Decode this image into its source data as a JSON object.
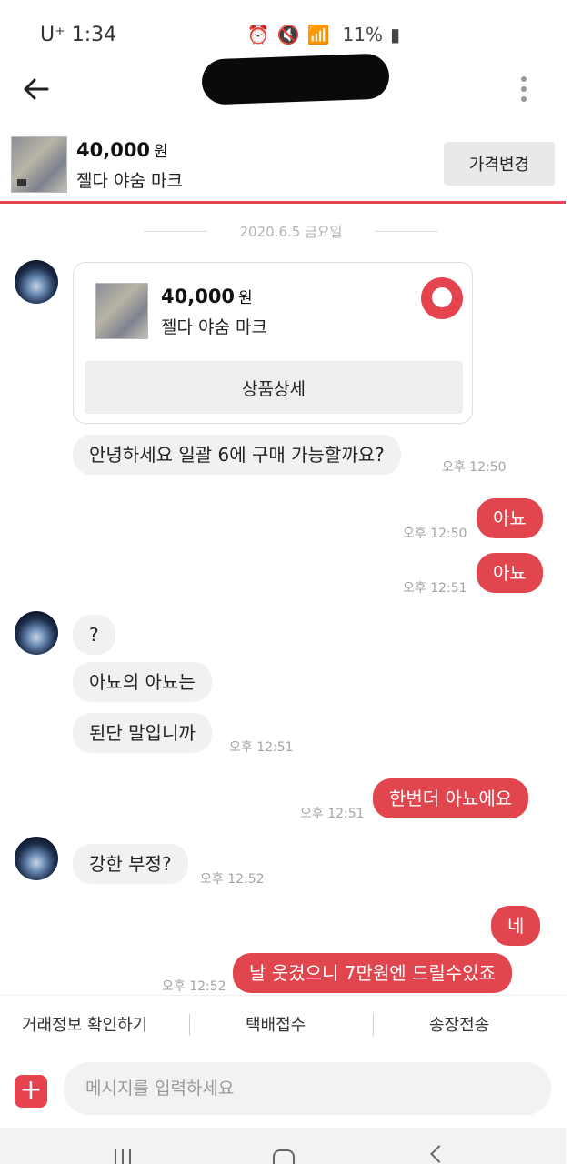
{
  "status_bar": {
    "carrier": "U⁺ 1:34",
    "battery": "11%"
  },
  "header": {
    "subtitle": ""
  },
  "product": {
    "price": "40,000",
    "currency": "원",
    "name": "젤다 야숨 마크",
    "price_change_label": "가격변경"
  },
  "chat": {
    "date": "2020.6.5 금요일",
    "card": {
      "price": "40,000",
      "currency": "원",
      "name": "젤다 야숨 마크",
      "detail_label": "상품상세"
    },
    "messages": [
      {
        "text": "안녕하세요 일괄 6에 구매 가능할까요?",
        "time": "오후 12:50"
      },
      {
        "text": "아뇨",
        "time": "오후 12:50"
      },
      {
        "text": "아뇨",
        "time": "오후 12:51"
      },
      {
        "text": "?"
      },
      {
        "text": "아뇨의 아뇨는"
      },
      {
        "text": "된단 말입니까",
        "time": "오후 12:51"
      },
      {
        "text": "한번더 아뇨에요",
        "time": "오후 12:51"
      },
      {
        "text": "강한 부정?",
        "time": "오후 12:52"
      },
      {
        "text": "네"
      },
      {
        "text": "날 웃겼으니 7만원엔 드릴수있죠",
        "time": "오후 12:52"
      }
    ]
  },
  "actions": {
    "trade_info": "거래정보 확인하기",
    "parcel": "택배접수",
    "invoice": "송장전송"
  },
  "composer": {
    "placeholder": "메시지를 입력하세요",
    "plus": "+"
  },
  "colors": {
    "accent": "#e5434d"
  }
}
